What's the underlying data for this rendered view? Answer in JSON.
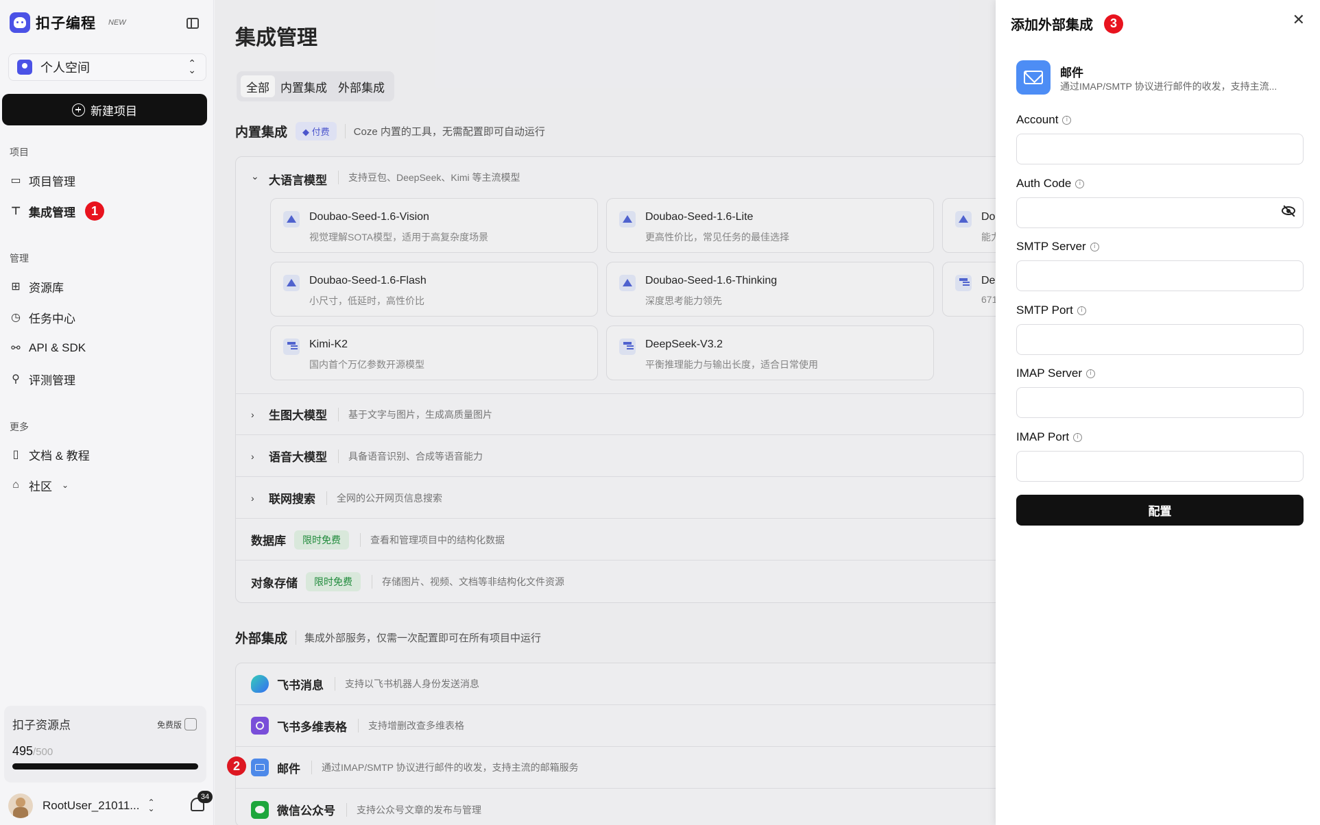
{
  "brand": {
    "name": "扣子编程",
    "tag": "NEW"
  },
  "workspace": {
    "label": "个人空间"
  },
  "new_project": {
    "label": "新建项目"
  },
  "sidebar": {
    "sections": {
      "project": "项目",
      "manage": "管理",
      "more": "更多"
    },
    "items": [
      {
        "label": "项目管理",
        "icon": "folder-icon"
      },
      {
        "label": "集成管理",
        "icon": "integration-icon",
        "active": true,
        "annotation": "1"
      },
      {
        "label": "资源库",
        "icon": "resource-icon"
      },
      {
        "label": "任务中心",
        "icon": "clock-icon"
      },
      {
        "label": "API & SDK",
        "icon": "api-icon"
      },
      {
        "label": "评测管理",
        "icon": "telescope-icon"
      },
      {
        "label": "文档 & 教程",
        "icon": "book-icon"
      },
      {
        "label": "社区",
        "icon": "store-icon"
      }
    ]
  },
  "resource_card": {
    "title": "扣子资源点",
    "plan": "免费版",
    "used": "495",
    "total": "/500",
    "used_fraction": 0.99
  },
  "user": {
    "name": "RootUser_21011...",
    "notifications": "34"
  },
  "main": {
    "title": "集成管理",
    "tabs": [
      "全部",
      "内置集成",
      "外部集成"
    ],
    "builtin": {
      "title": "内置集成",
      "paid_tag": "付费",
      "desc": "Coze 内置的工具，无需配置即可自动运行",
      "groups": [
        {
          "title": "大语言模型",
          "desc": "支持豆包、DeepSeek、Kimi 等主流模型",
          "expanded": true
        },
        {
          "title": "生图大模型",
          "desc": "基于文字与图片，生成高质量图片"
        },
        {
          "title": "语音大模型",
          "desc": "具备语音识别、合成等语音能力"
        },
        {
          "title": "联网搜索",
          "desc": "全网的公开网页信息搜索"
        },
        {
          "title": "数据库",
          "tag": "限时免费",
          "desc": "查看和管理项目中的结构化数据"
        },
        {
          "title": "对象存储",
          "tag": "限时免费",
          "desc": "存储图片、视频、文档等非结构化文件资源"
        }
      ],
      "models": [
        {
          "name": "Doubao-Seed-1.6-Vision",
          "desc": "视觉理解SOTA模型，适用于高复杂度场景"
        },
        {
          "name": "Doubao-Seed-1.6-Lite",
          "desc": "更高性价比，常见任务的最佳选择"
        },
        {
          "name": "Dou",
          "desc": "能力"
        },
        {
          "name": "Doubao-Seed-1.6-Flash",
          "desc": "小尺寸，低延时，高性价比"
        },
        {
          "name": "Doubao-Seed-1.6-Thinking",
          "desc": "深度思考能力领先"
        },
        {
          "name": "Dee",
          "desc": "671"
        },
        {
          "name": "Kimi-K2",
          "desc": "国内首个万亿参数开源模型"
        },
        {
          "name": "DeepSeek-V3.2",
          "desc": "平衡推理能力与输出长度，适合日常使用"
        }
      ]
    },
    "external": {
      "title": "外部集成",
      "desc": "集成外部服务，仅需一次配置即可在所有项目中运行",
      "items": [
        {
          "title": "飞书消息",
          "desc": "支持以飞书机器人身份发送消息"
        },
        {
          "title": "飞书多维表格",
          "desc": "支持增删改查多维表格"
        },
        {
          "title": "邮件",
          "desc": "通过IMAP/SMTP 协议进行邮件的收发，支持主流的邮箱服务",
          "annotation": "2"
        },
        {
          "title": "微信公众号",
          "desc": "支持公众号文章的发布与管理"
        }
      ]
    }
  },
  "drawer": {
    "title": "添加外部集成",
    "annotation": "3",
    "service": {
      "name": "邮件",
      "desc": "通过IMAP/SMTP 协议进行邮件的收发，支持主流..."
    },
    "fields": [
      {
        "label": "Account",
        "value": ""
      },
      {
        "label": "Auth Code",
        "value": ""
      },
      {
        "label": "SMTP Server",
        "value": ""
      },
      {
        "label": "SMTP Port",
        "value": ""
      },
      {
        "label": "IMAP Server",
        "value": ""
      },
      {
        "label": "IMAP Port",
        "value": ""
      }
    ],
    "submit": "配置"
  },
  "colors": {
    "accent": "#4b52e6",
    "annotation": "#e8131e",
    "free_tag": "#1d8f3a",
    "mail": "#4d8df5"
  }
}
